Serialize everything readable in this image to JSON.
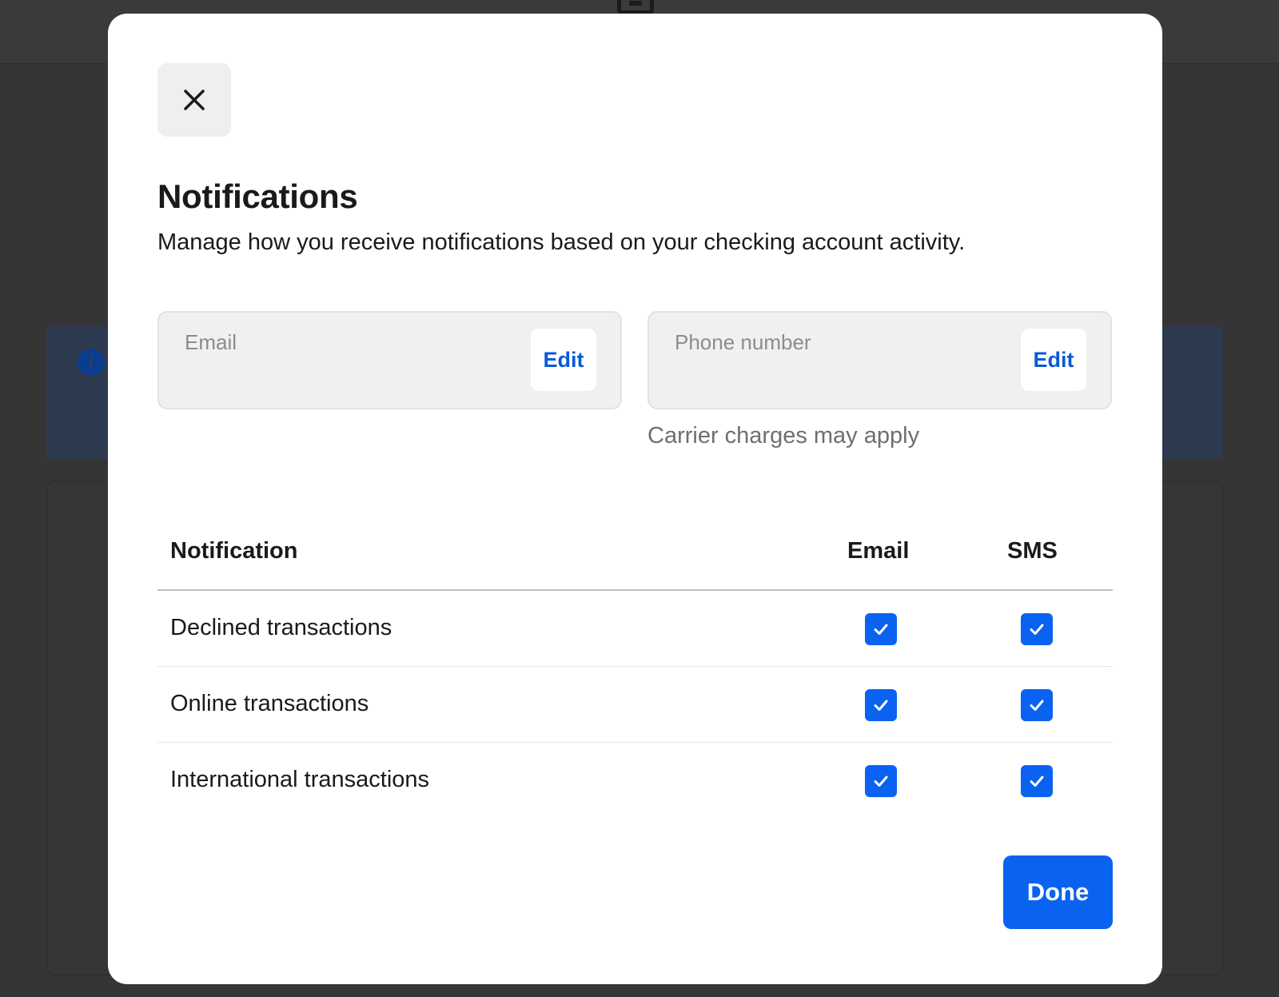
{
  "modal": {
    "title": "Notifications",
    "subtitle": "Manage how you receive notifications based on your checking account activity.",
    "close_icon": "close-icon"
  },
  "contacts": {
    "email": {
      "label": "Email",
      "value": "",
      "edit_label": "Edit"
    },
    "phone": {
      "label": "Phone number",
      "value": "",
      "edit_label": "Edit",
      "note": "Carrier charges may apply"
    }
  },
  "table": {
    "headers": {
      "name": "Notification",
      "email": "Email",
      "sms": "SMS"
    },
    "rows": [
      {
        "label": "Declined transactions",
        "email": true,
        "sms": true
      },
      {
        "label": "Online transactions",
        "email": true,
        "sms": true
      },
      {
        "label": "International transactions",
        "email": true,
        "sms": true
      }
    ]
  },
  "actions": {
    "done_label": "Done"
  },
  "colors": {
    "accent": "#0a63f0",
    "link": "#0a5ad4",
    "backdrop": "#353535"
  }
}
